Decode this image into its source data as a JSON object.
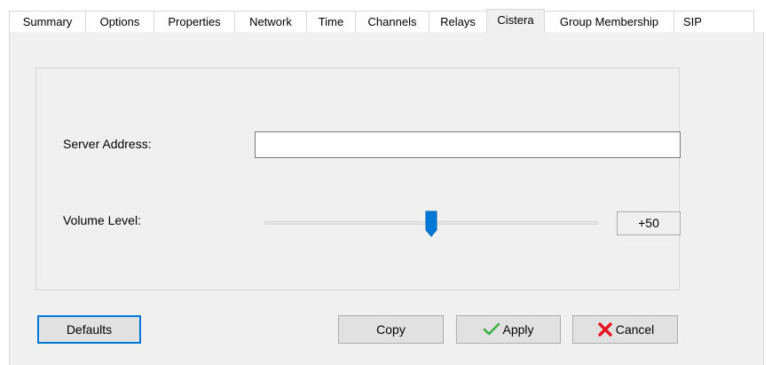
{
  "tabs": [
    {
      "label": "Summary"
    },
    {
      "label": "Options"
    },
    {
      "label": "Properties"
    },
    {
      "label": "Network"
    },
    {
      "label": "Time"
    },
    {
      "label": "Channels"
    },
    {
      "label": "Relays"
    },
    {
      "label": "Cistera"
    },
    {
      "label": "Group Membership"
    },
    {
      "label": "SIP"
    }
  ],
  "active_tab": "Cistera",
  "server": {
    "label": "Server Address:",
    "value": ""
  },
  "volume": {
    "label": "Volume Level:",
    "value_text": "+50",
    "fraction": 0.5
  },
  "buttons": {
    "defaults": "Defaults",
    "copy": "Copy",
    "apply": "Apply",
    "cancel": "Cancel"
  },
  "colors": {
    "accent": "#0078d7",
    "apply_icon": "#3cb043",
    "cancel_icon": "#e81123"
  },
  "icons": {
    "apply": "checkmark-icon",
    "cancel": "red-x-icon"
  }
}
